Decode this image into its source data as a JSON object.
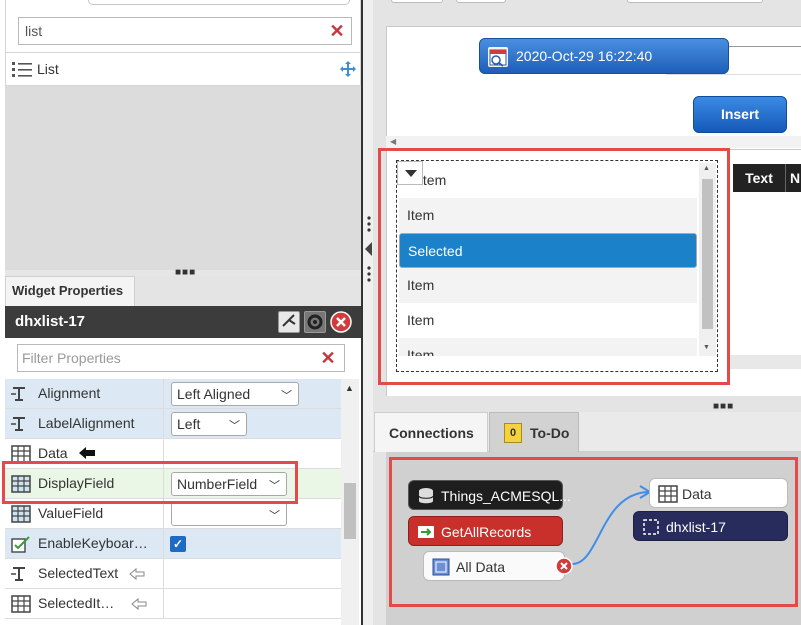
{
  "mashup_panel": {
    "search_value": "list",
    "widget_result_label": "List"
  },
  "widget_properties": {
    "tab_label": "Widget Properties",
    "widget_name": "dhxlist-17",
    "filter_placeholder": "Filter Properties",
    "rows": [
      {
        "name": "Alignment",
        "value": "Left Aligned"
      },
      {
        "name": "LabelAlignment",
        "value": "Left"
      },
      {
        "name": "Data",
        "value": ""
      },
      {
        "name": "DisplayField",
        "value": "NumberField"
      },
      {
        "name": "ValueField",
        "value": ""
      },
      {
        "name": "EnableKeyboar…",
        "value": "checked"
      },
      {
        "name": "SelectedText",
        "value": ""
      },
      {
        "name": "SelectedIt…",
        "value": ""
      }
    ]
  },
  "canvas": {
    "date_button_label": "2020-Oct-29 16:22:40",
    "insert_button_label": "Insert",
    "grid_header_text": "Text",
    "grid_header_next": "N",
    "list_items": [
      "Item",
      "Item",
      "Selected",
      "Item",
      "Item",
      "Item"
    ]
  },
  "connections": {
    "tab_connections": "Connections",
    "tab_todo": "To-Do",
    "todo_badge": "0",
    "nodes": {
      "thing": "Things_ACMESQL...",
      "service": "GetAllRecords",
      "all_data": "All Data",
      "data_target": "Data",
      "widget_target": "dhxlist-17"
    }
  },
  "colors": {
    "highlight": "#e34a4a",
    "selected_item": "#1b82c9",
    "header_dark": "#3c3c3c",
    "button_blue": "#1d5fb8"
  }
}
